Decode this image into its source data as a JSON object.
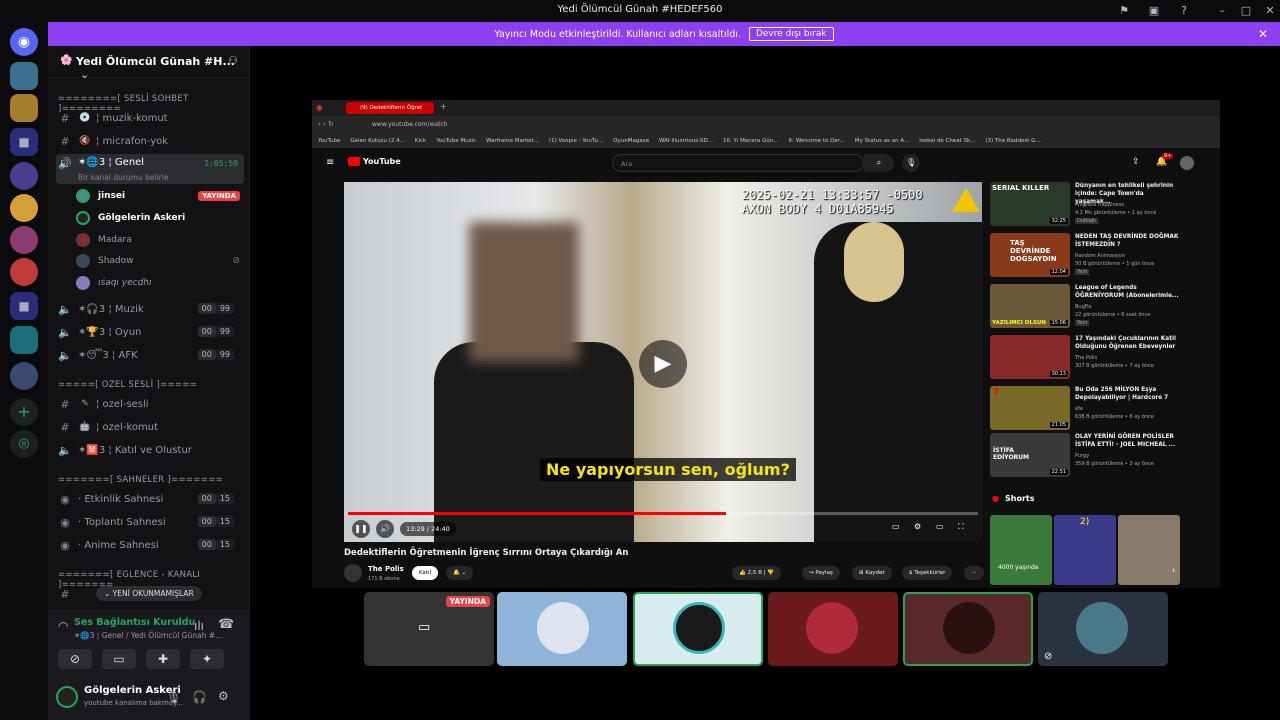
{
  "window": {
    "title": "Yedi Ölümcül Günah #HEDEF560"
  },
  "banner": {
    "text": "Yayıncı Modu etkinleştirildi. Kullanıcı adları kısaltıldı.",
    "button": "Devre dışı bırak"
  },
  "server": {
    "name": "Yedi Ölümcül Günah #H..."
  },
  "sidebar": {
    "cat_voice": "========[ SESLİ SOHBET ]========",
    "ch1": "¦ muzik-komut",
    "ch2": "¦ micrafon-yok",
    "genel": "✶🌐3 ¦ Genel",
    "genel_time": "1:05:59",
    "genel_status": "Bir kanal durumu belirle",
    "users": [
      "jinsei",
      "Gölgelerin Askeri",
      "Madara",
      "Shadow",
      "ıśaqı yecdhı"
    ],
    "live": "YAYINDA",
    "muzik": "✶🎧3 ¦ Muzik",
    "oyun": "✶🏆3 ¦ Oyun",
    "afk": "✶😴3 ¦ AFK",
    "cnt00": "00",
    "cnt99": "99",
    "cnt15": "15",
    "cat_ozel": "=====[ OZEL SESLİ ]=====",
    "ozel1": "¦ ozel-sesli",
    "ozel2": "¦ ozel-komut",
    "ozel3": "✶🈲3 ¦ Katıl ve Olustur",
    "cat_sahne": "=======[ SAHNELER ]=======",
    "s1": "· Etkinlik Sahnesi",
    "s2": "· Toplantı Sahnesi",
    "s3": "· Anime Sahnesi",
    "cat_eg": "=======[ EGLENCE - KANALI ]=======",
    "unread": "YENİ OKUNMAMIŞLAR"
  },
  "voice": {
    "status": "Ses Bağlantısı Kuruldu",
    "channel": "✶🌐3 ¦ Genel / Yedi Ölümcül Günah #..."
  },
  "user": {
    "name": "Gölgelerin Askeri",
    "status": "youtube kanalıma bakmay..."
  },
  "browser": {
    "tab": "(9) Dedektiflerin Öğret",
    "url": "www.youtube.com/watch",
    "bookmarks": [
      "YouTube",
      "Gelen Kutusu (2.4...",
      "Kick",
      "YouTube Music",
      "Warframe Market...",
      "(1) Voopie - YouTu...",
      "OyunMagaza",
      "WAI-illustrious-SD...",
      "10. Yı Macera Gün...",
      "It: Welcome to Der...",
      "My Status as an A...",
      "Isekai de Cheat Sk...",
      "(3) The Baddest G..."
    ],
    "search_placeholder": "Ara",
    "yt_logo": "YouTube",
    "notif": "9+"
  },
  "video": {
    "timestamp": "2025-02-21 13:33:57 -0500",
    "device": "AXON BODY 4 D01A85945",
    "subtitle": "Ne yapıyorsun sen, oğlum?",
    "time": "13:29 / 24:40",
    "progress": 0.6,
    "title": "Dedektiflerin Öğretmenin İğrenç Sırrını Ortaya Çıkardığı An",
    "channel": "The Polis",
    "subs": "171 B abone",
    "join": "Katıl",
    "likes": "2,5 B",
    "share": "Paylaş",
    "save": "Kaydet",
    "thanks": "Teşekkürler"
  },
  "recs": [
    {
      "title": "Dünyanın en tehlikeli şehrinin içinde: Cape Town'da yaşamak...",
      "channel": "Progress Happiness",
      "meta": "4,2 Mn görüntüleme • 1 ay önce",
      "dur": "32:25",
      "badge": "Dublajlı",
      "thumb_text": "SERIAL KILLER"
    },
    {
      "title": "NEDEN TAŞ DEVRİNDE DOĞMAK İSTEMEZDİN ?",
      "channel": "Random Animasyon",
      "meta": "50 B görüntüleme • 1 gün önce",
      "dur": "12:04",
      "badge": "Yeni",
      "thumb_text": "TAŞ DEVRİNDE DOĞSAYDIN"
    },
    {
      "title": "League of Legends ÖĞRENİYORUM (Abonelerimle...",
      "channel": "BugFix",
      "meta": "22 görüntüleme • 6 saat önce",
      "dur": "15:06",
      "badge": "Yeni",
      "thumb_text": "YAZILIMCI OLSUN"
    },
    {
      "title": "17 Yaşındaki Çocuklarının Katil Olduğunu Öğrenen Ebeveynler",
      "channel": "The Polis",
      "meta": "307 B görüntüleme • 7 ay önce",
      "dur": "30:13",
      "badge": "",
      "thumb_text": ""
    },
    {
      "title": "Bu Oda 256 MİLYON Eşya Depolayabiliyor | Hardcore 7",
      "channel": "efe",
      "meta": "638 B görüntüleme • 6 ay önce",
      "dur": "21:05",
      "badge": "",
      "thumb_text": "7"
    },
    {
      "title": "OLAY YERİNİ GÖREN POLİSLER İSTİFA ETTİ! - JOEL MICHEAL ...",
      "channel": "Purgy",
      "meta": "359 B görüntüleme • 3 ay önce",
      "dur": "22:51",
      "badge": "",
      "thumb_text": "İSTİFA EDİYORUM"
    }
  ],
  "shorts": {
    "label": "Shorts",
    "s1": "4000 yaşında",
    "s2": "2)"
  },
  "tiles": {
    "live": "YAYINDA"
  },
  "colors": {
    "accent": "#8e3ff2",
    "live": "#ed4245",
    "online": "#23a55a",
    "yt_red": "#ff0000"
  }
}
